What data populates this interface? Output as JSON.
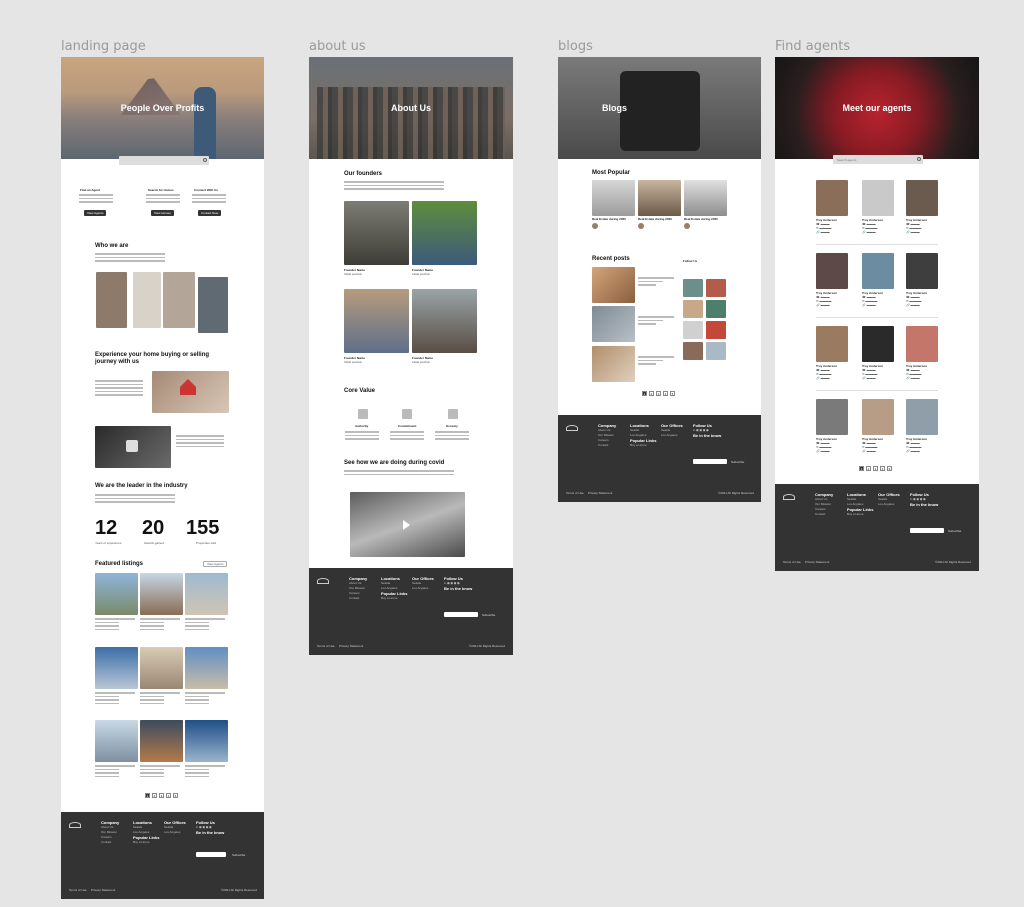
{
  "labels": {
    "landing": "landing page",
    "about": "about us",
    "blogs": "blogs",
    "agents": "Find agents"
  },
  "landing": {
    "hero_title": "People Over Profits",
    "cards": [
      {
        "title": "Find an Agent",
        "btn": "View Agents"
      },
      {
        "title": "Search for Homes",
        "btn": "View Homes"
      },
      {
        "title": "Connect With Us",
        "btn": "Contact Now"
      }
    ],
    "who_we_are": "Who we are",
    "experience_title": "Experience your home buying or selling journey with us",
    "leader_title": "We are the leader in the industry",
    "stats": [
      {
        "value": "12",
        "caption": "Years of experience"
      },
      {
        "value": "20",
        "caption": "Awards gained"
      },
      {
        "value": "155",
        "caption": "Properties sold"
      }
    ],
    "featured_title": "Featured listings",
    "featured_filter": "View Agents",
    "pager": [
      "1",
      "2",
      "3",
      "4",
      "5"
    ]
  },
  "about": {
    "hero_title": "About Us",
    "founders_title": "Our founders",
    "founders": [
      {
        "name": "Founder Name",
        "role": "Initial position"
      },
      {
        "name": "Founder Name",
        "role": "Initial position"
      },
      {
        "name": "Founder Name",
        "role": "Initial position"
      },
      {
        "name": "Founder Name",
        "role": "Initial position"
      }
    ],
    "core_value_title": "Core Value",
    "core_values": [
      "Authority",
      "Commitment",
      "Honesty"
    ],
    "covid_title": "See how we are doing during covid"
  },
  "blogs": {
    "hero_title": "Blogs",
    "most_popular": "Most Popular",
    "popular_posts": [
      "Real Estate during 2020",
      "Real Estate during 2020",
      "Real Estate during 2020"
    ],
    "recent_posts": "Recent posts",
    "follow_us": "Follow Us",
    "pager": [
      "1",
      "2",
      "3",
      "4",
      "5"
    ]
  },
  "agents": {
    "hero_title": "Meet our agents",
    "search_placeholder": "Search agents",
    "agent_name": "Troy Anderson",
    "pager": [
      "1",
      "2",
      "3",
      "4",
      "5"
    ]
  },
  "footer": {
    "company": "Company",
    "locations": "Locations",
    "offices": "Our Offices",
    "follow": "Follow Us",
    "popular": "Popular Links",
    "loop": "Be in the know",
    "subscribe": "Subscribe",
    "terms": "Terms of Use",
    "privacy": "Privacy Statement",
    "rights": "©2021 All Rights Reserved"
  },
  "colors": {
    "dark": "#333333",
    "canvas": "#e5e5e5"
  }
}
